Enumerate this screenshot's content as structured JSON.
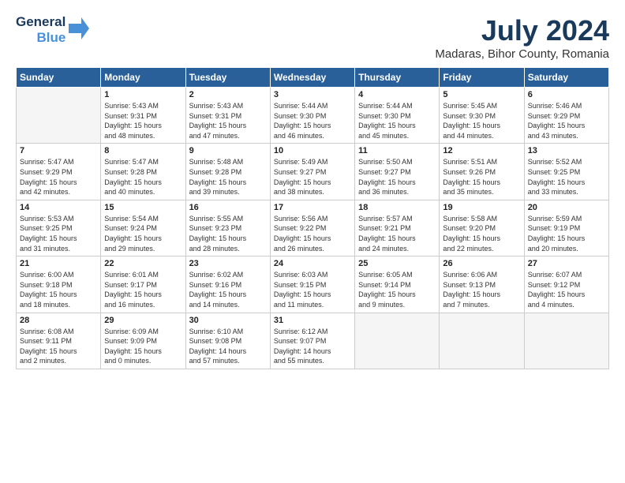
{
  "header": {
    "logo_line1": "General",
    "logo_line2": "Blue",
    "month_title": "July 2024",
    "location": "Madaras, Bihor County, Romania"
  },
  "weekdays": [
    "Sunday",
    "Monday",
    "Tuesday",
    "Wednesday",
    "Thursday",
    "Friday",
    "Saturday"
  ],
  "weeks": [
    [
      {
        "day": "",
        "info": ""
      },
      {
        "day": "1",
        "info": "Sunrise: 5:43 AM\nSunset: 9:31 PM\nDaylight: 15 hours\nand 48 minutes."
      },
      {
        "day": "2",
        "info": "Sunrise: 5:43 AM\nSunset: 9:31 PM\nDaylight: 15 hours\nand 47 minutes."
      },
      {
        "day": "3",
        "info": "Sunrise: 5:44 AM\nSunset: 9:30 PM\nDaylight: 15 hours\nand 46 minutes."
      },
      {
        "day": "4",
        "info": "Sunrise: 5:44 AM\nSunset: 9:30 PM\nDaylight: 15 hours\nand 45 minutes."
      },
      {
        "day": "5",
        "info": "Sunrise: 5:45 AM\nSunset: 9:30 PM\nDaylight: 15 hours\nand 44 minutes."
      },
      {
        "day": "6",
        "info": "Sunrise: 5:46 AM\nSunset: 9:29 PM\nDaylight: 15 hours\nand 43 minutes."
      }
    ],
    [
      {
        "day": "7",
        "info": "Sunrise: 5:47 AM\nSunset: 9:29 PM\nDaylight: 15 hours\nand 42 minutes."
      },
      {
        "day": "8",
        "info": "Sunrise: 5:47 AM\nSunset: 9:28 PM\nDaylight: 15 hours\nand 40 minutes."
      },
      {
        "day": "9",
        "info": "Sunrise: 5:48 AM\nSunset: 9:28 PM\nDaylight: 15 hours\nand 39 minutes."
      },
      {
        "day": "10",
        "info": "Sunrise: 5:49 AM\nSunset: 9:27 PM\nDaylight: 15 hours\nand 38 minutes."
      },
      {
        "day": "11",
        "info": "Sunrise: 5:50 AM\nSunset: 9:27 PM\nDaylight: 15 hours\nand 36 minutes."
      },
      {
        "day": "12",
        "info": "Sunrise: 5:51 AM\nSunset: 9:26 PM\nDaylight: 15 hours\nand 35 minutes."
      },
      {
        "day": "13",
        "info": "Sunrise: 5:52 AM\nSunset: 9:25 PM\nDaylight: 15 hours\nand 33 minutes."
      }
    ],
    [
      {
        "day": "14",
        "info": "Sunrise: 5:53 AM\nSunset: 9:25 PM\nDaylight: 15 hours\nand 31 minutes."
      },
      {
        "day": "15",
        "info": "Sunrise: 5:54 AM\nSunset: 9:24 PM\nDaylight: 15 hours\nand 29 minutes."
      },
      {
        "day": "16",
        "info": "Sunrise: 5:55 AM\nSunset: 9:23 PM\nDaylight: 15 hours\nand 28 minutes."
      },
      {
        "day": "17",
        "info": "Sunrise: 5:56 AM\nSunset: 9:22 PM\nDaylight: 15 hours\nand 26 minutes."
      },
      {
        "day": "18",
        "info": "Sunrise: 5:57 AM\nSunset: 9:21 PM\nDaylight: 15 hours\nand 24 minutes."
      },
      {
        "day": "19",
        "info": "Sunrise: 5:58 AM\nSunset: 9:20 PM\nDaylight: 15 hours\nand 22 minutes."
      },
      {
        "day": "20",
        "info": "Sunrise: 5:59 AM\nSunset: 9:19 PM\nDaylight: 15 hours\nand 20 minutes."
      }
    ],
    [
      {
        "day": "21",
        "info": "Sunrise: 6:00 AM\nSunset: 9:18 PM\nDaylight: 15 hours\nand 18 minutes."
      },
      {
        "day": "22",
        "info": "Sunrise: 6:01 AM\nSunset: 9:17 PM\nDaylight: 15 hours\nand 16 minutes."
      },
      {
        "day": "23",
        "info": "Sunrise: 6:02 AM\nSunset: 9:16 PM\nDaylight: 15 hours\nand 14 minutes."
      },
      {
        "day": "24",
        "info": "Sunrise: 6:03 AM\nSunset: 9:15 PM\nDaylight: 15 hours\nand 11 minutes."
      },
      {
        "day": "25",
        "info": "Sunrise: 6:05 AM\nSunset: 9:14 PM\nDaylight: 15 hours\nand 9 minutes."
      },
      {
        "day": "26",
        "info": "Sunrise: 6:06 AM\nSunset: 9:13 PM\nDaylight: 15 hours\nand 7 minutes."
      },
      {
        "day": "27",
        "info": "Sunrise: 6:07 AM\nSunset: 9:12 PM\nDaylight: 15 hours\nand 4 minutes."
      }
    ],
    [
      {
        "day": "28",
        "info": "Sunrise: 6:08 AM\nSunset: 9:11 PM\nDaylight: 15 hours\nand 2 minutes."
      },
      {
        "day": "29",
        "info": "Sunrise: 6:09 AM\nSunset: 9:09 PM\nDaylight: 15 hours\nand 0 minutes."
      },
      {
        "day": "30",
        "info": "Sunrise: 6:10 AM\nSunset: 9:08 PM\nDaylight: 14 hours\nand 57 minutes."
      },
      {
        "day": "31",
        "info": "Sunrise: 6:12 AM\nSunset: 9:07 PM\nDaylight: 14 hours\nand 55 minutes."
      },
      {
        "day": "",
        "info": ""
      },
      {
        "day": "",
        "info": ""
      },
      {
        "day": "",
        "info": ""
      }
    ]
  ]
}
